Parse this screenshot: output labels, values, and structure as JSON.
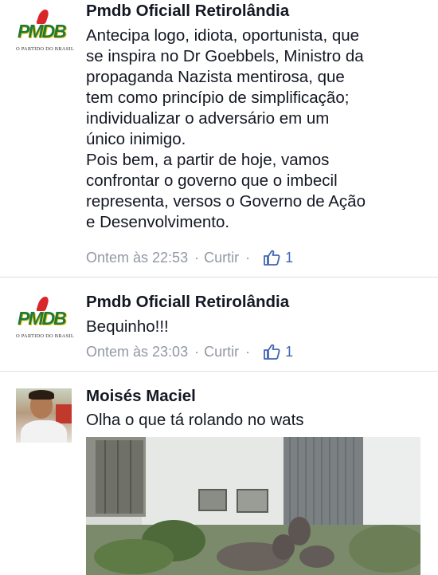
{
  "comments": [
    {
      "author": "Pmdb Oficiall Retirolândia",
      "logo_text": "PMDB",
      "logo_tagline": "O PARTIDO DO BRASIL",
      "text": "Antecipa logo, idiota, oportunista, que\nse inspira no Dr Goebbels, Ministro da\npropaganda Nazista mentirosa, que\ntem como princípio de simplificação;\nindividualizar o adversário em um\núnico inimigo.\nPois bem, a partir de hoje, vamos\nconfrontar o governo que o imbecil\nrepresenta, versos o Governo de Ação\ne Desenvolvimento.",
      "time": "Ontem às 22:53",
      "like_action": "Curtir",
      "separator": "·",
      "likes": "1"
    },
    {
      "author": "Pmdb Oficiall Retirolândia",
      "logo_text": "PMDB",
      "logo_tagline": "O PARTIDO DO BRASIL",
      "text": "Bequinho!!!",
      "time": "Ontem às 23:03",
      "like_action": "Curtir",
      "separator": "·",
      "likes": "1"
    },
    {
      "author": "Moisés Maciel",
      "text": "Olha o que tá rolando no wats"
    }
  ],
  "colors": {
    "name": "#141823",
    "meta": "#9197a3",
    "like": "#4267b2",
    "divider": "#dddfe2"
  }
}
